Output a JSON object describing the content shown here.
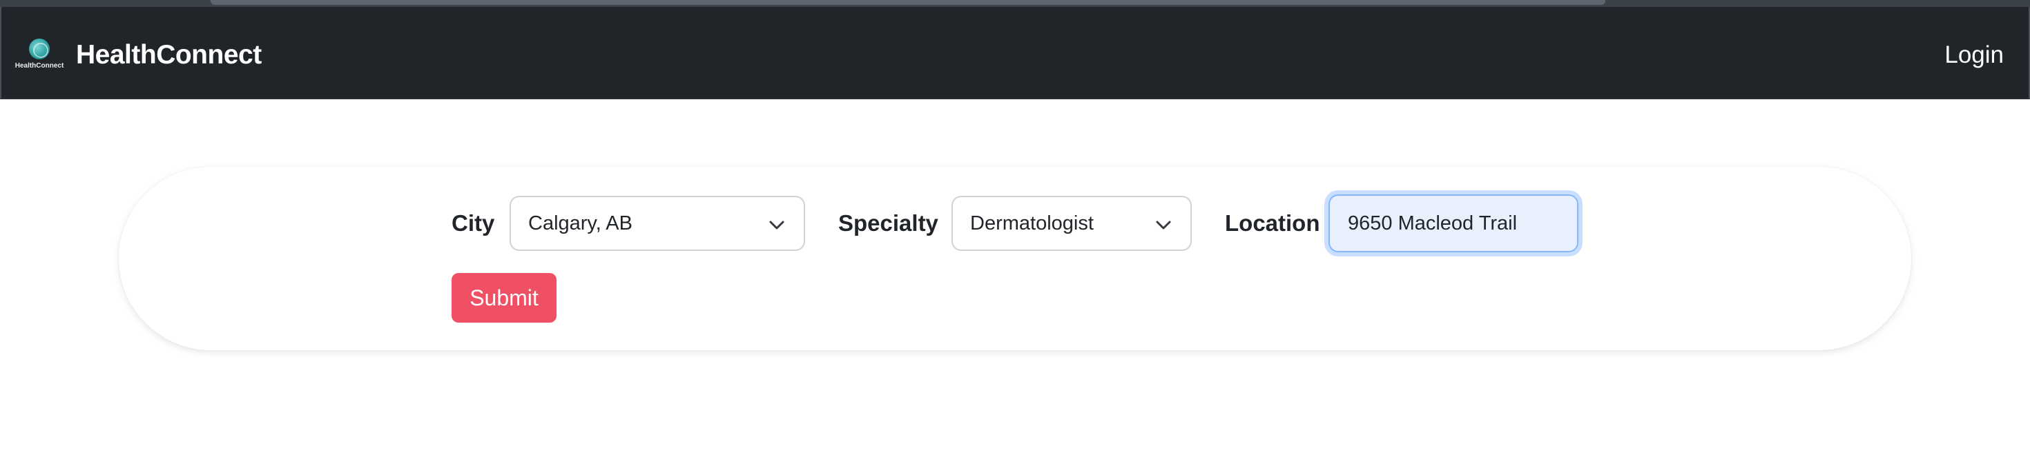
{
  "navbar": {
    "logo_text": "HealthConnect",
    "brand": "HealthConnect",
    "login_label": "Login"
  },
  "search": {
    "city": {
      "label": "City",
      "selected": "Calgary, AB"
    },
    "specialty": {
      "label": "Specialty",
      "selected": "Dermatologist"
    },
    "location": {
      "label": "Location",
      "value": "9650 Macleod Trail"
    },
    "submit_label": "Submit"
  },
  "colors": {
    "navbar_bg": "#212529",
    "submit_bg": "#ef5064",
    "input_focus_bg": "#e8f0fe",
    "logo_accent": "#2fa3a3"
  },
  "icons": {
    "logo": "globe-logo-icon",
    "select_arrow": "chevron-down-icon"
  }
}
